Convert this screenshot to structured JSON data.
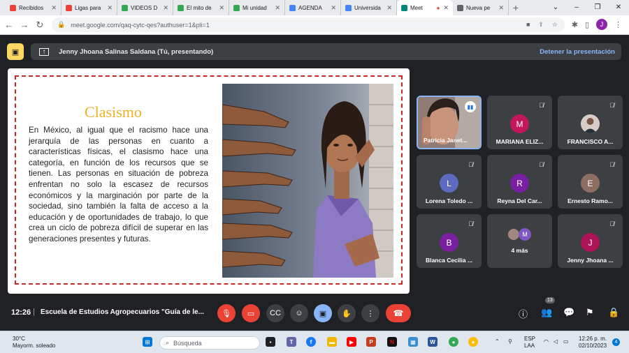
{
  "browser": {
    "tabs": [
      {
        "label": "Recibidos",
        "icon": "gmail-icon",
        "color": "#ea4335"
      },
      {
        "label": "Ligas para",
        "icon": "gmail-icon",
        "color": "#ea4335"
      },
      {
        "label": "VIDEOS D",
        "icon": "drive-icon",
        "color": "#34a853"
      },
      {
        "label": "El mito de",
        "icon": "drive-icon",
        "color": "#34a853"
      },
      {
        "label": "Mi unidad",
        "icon": "drive-icon",
        "color": "#34a853"
      },
      {
        "label": "AGENDA",
        "icon": "docs-icon",
        "color": "#4285f4"
      },
      {
        "label": "Universida",
        "icon": "sites-icon",
        "color": "#4285f4"
      },
      {
        "label": "Meet",
        "icon": "meet-icon",
        "color": "#00897b"
      },
      {
        "label": "Nueva pe",
        "icon": "globe-icon",
        "color": "#5f6368"
      }
    ],
    "url": "meet.google.com/qaq-cytc-qes?authuser=1&pli=1",
    "profile_initial": "J"
  },
  "presentation": {
    "presenter": "Jenny Jhoana Salinas Saldana (Tú, presentando)",
    "stop_label": "Detener la presentación"
  },
  "slide": {
    "title": "Clasismo",
    "body": "En México, al igual que el racismo hace una jerarquía de las personas en cuanto a características físicas, el clasismo hace una categoría, en función de los recursos que se tienen. Las personas en situación de pobreza enfrentan no solo la escasez de recursos económicos y la marginación por parte de la sociedad, sino también la falta de acceso a la educación y de oportunidades de trabajo, lo que crea un ciclo de pobreza difícil de superar en las generaciones presentes y futuras."
  },
  "participants": [
    {
      "name": "Patricia Janet...",
      "initial": "",
      "color": "#5f6368",
      "speaking": true
    },
    {
      "name": "MARIANA ELIZ...",
      "initial": "M",
      "color": "#c2185b"
    },
    {
      "name": "FRANCISCO A...",
      "initial": "",
      "color": "#8d6e63"
    },
    {
      "name": "Lorena Toledo ...",
      "initial": "L",
      "color": "#5c6bc0"
    },
    {
      "name": "Reyna Del Car...",
      "initial": "R",
      "color": "#7b1fa2"
    },
    {
      "name": "Ernesto Ramo...",
      "initial": "E",
      "color": "#8d6e63"
    },
    {
      "name": "Blanca Cecilia ...",
      "initial": "B",
      "color": "#7b1fa2"
    },
    {
      "name": "4 más",
      "initial": "M",
      "color": "#7e57c2"
    },
    {
      "name": "Jenny Jhoana ...",
      "initial": "J",
      "color": "#ad1457"
    }
  ],
  "controls": {
    "time": "12:26",
    "meeting_name": "Escuela de Estudios Agropecuarios \"Guía de le...",
    "people_count": "13"
  },
  "taskbar": {
    "temperature": "30°C",
    "weather": "Mayorm. soleado",
    "search_placeholder": "Búsqueda",
    "lang": "ESP",
    "region": "LAA",
    "clock_time": "12:26 p. m.",
    "clock_date": "02/10/2023",
    "notification_count": "4"
  }
}
